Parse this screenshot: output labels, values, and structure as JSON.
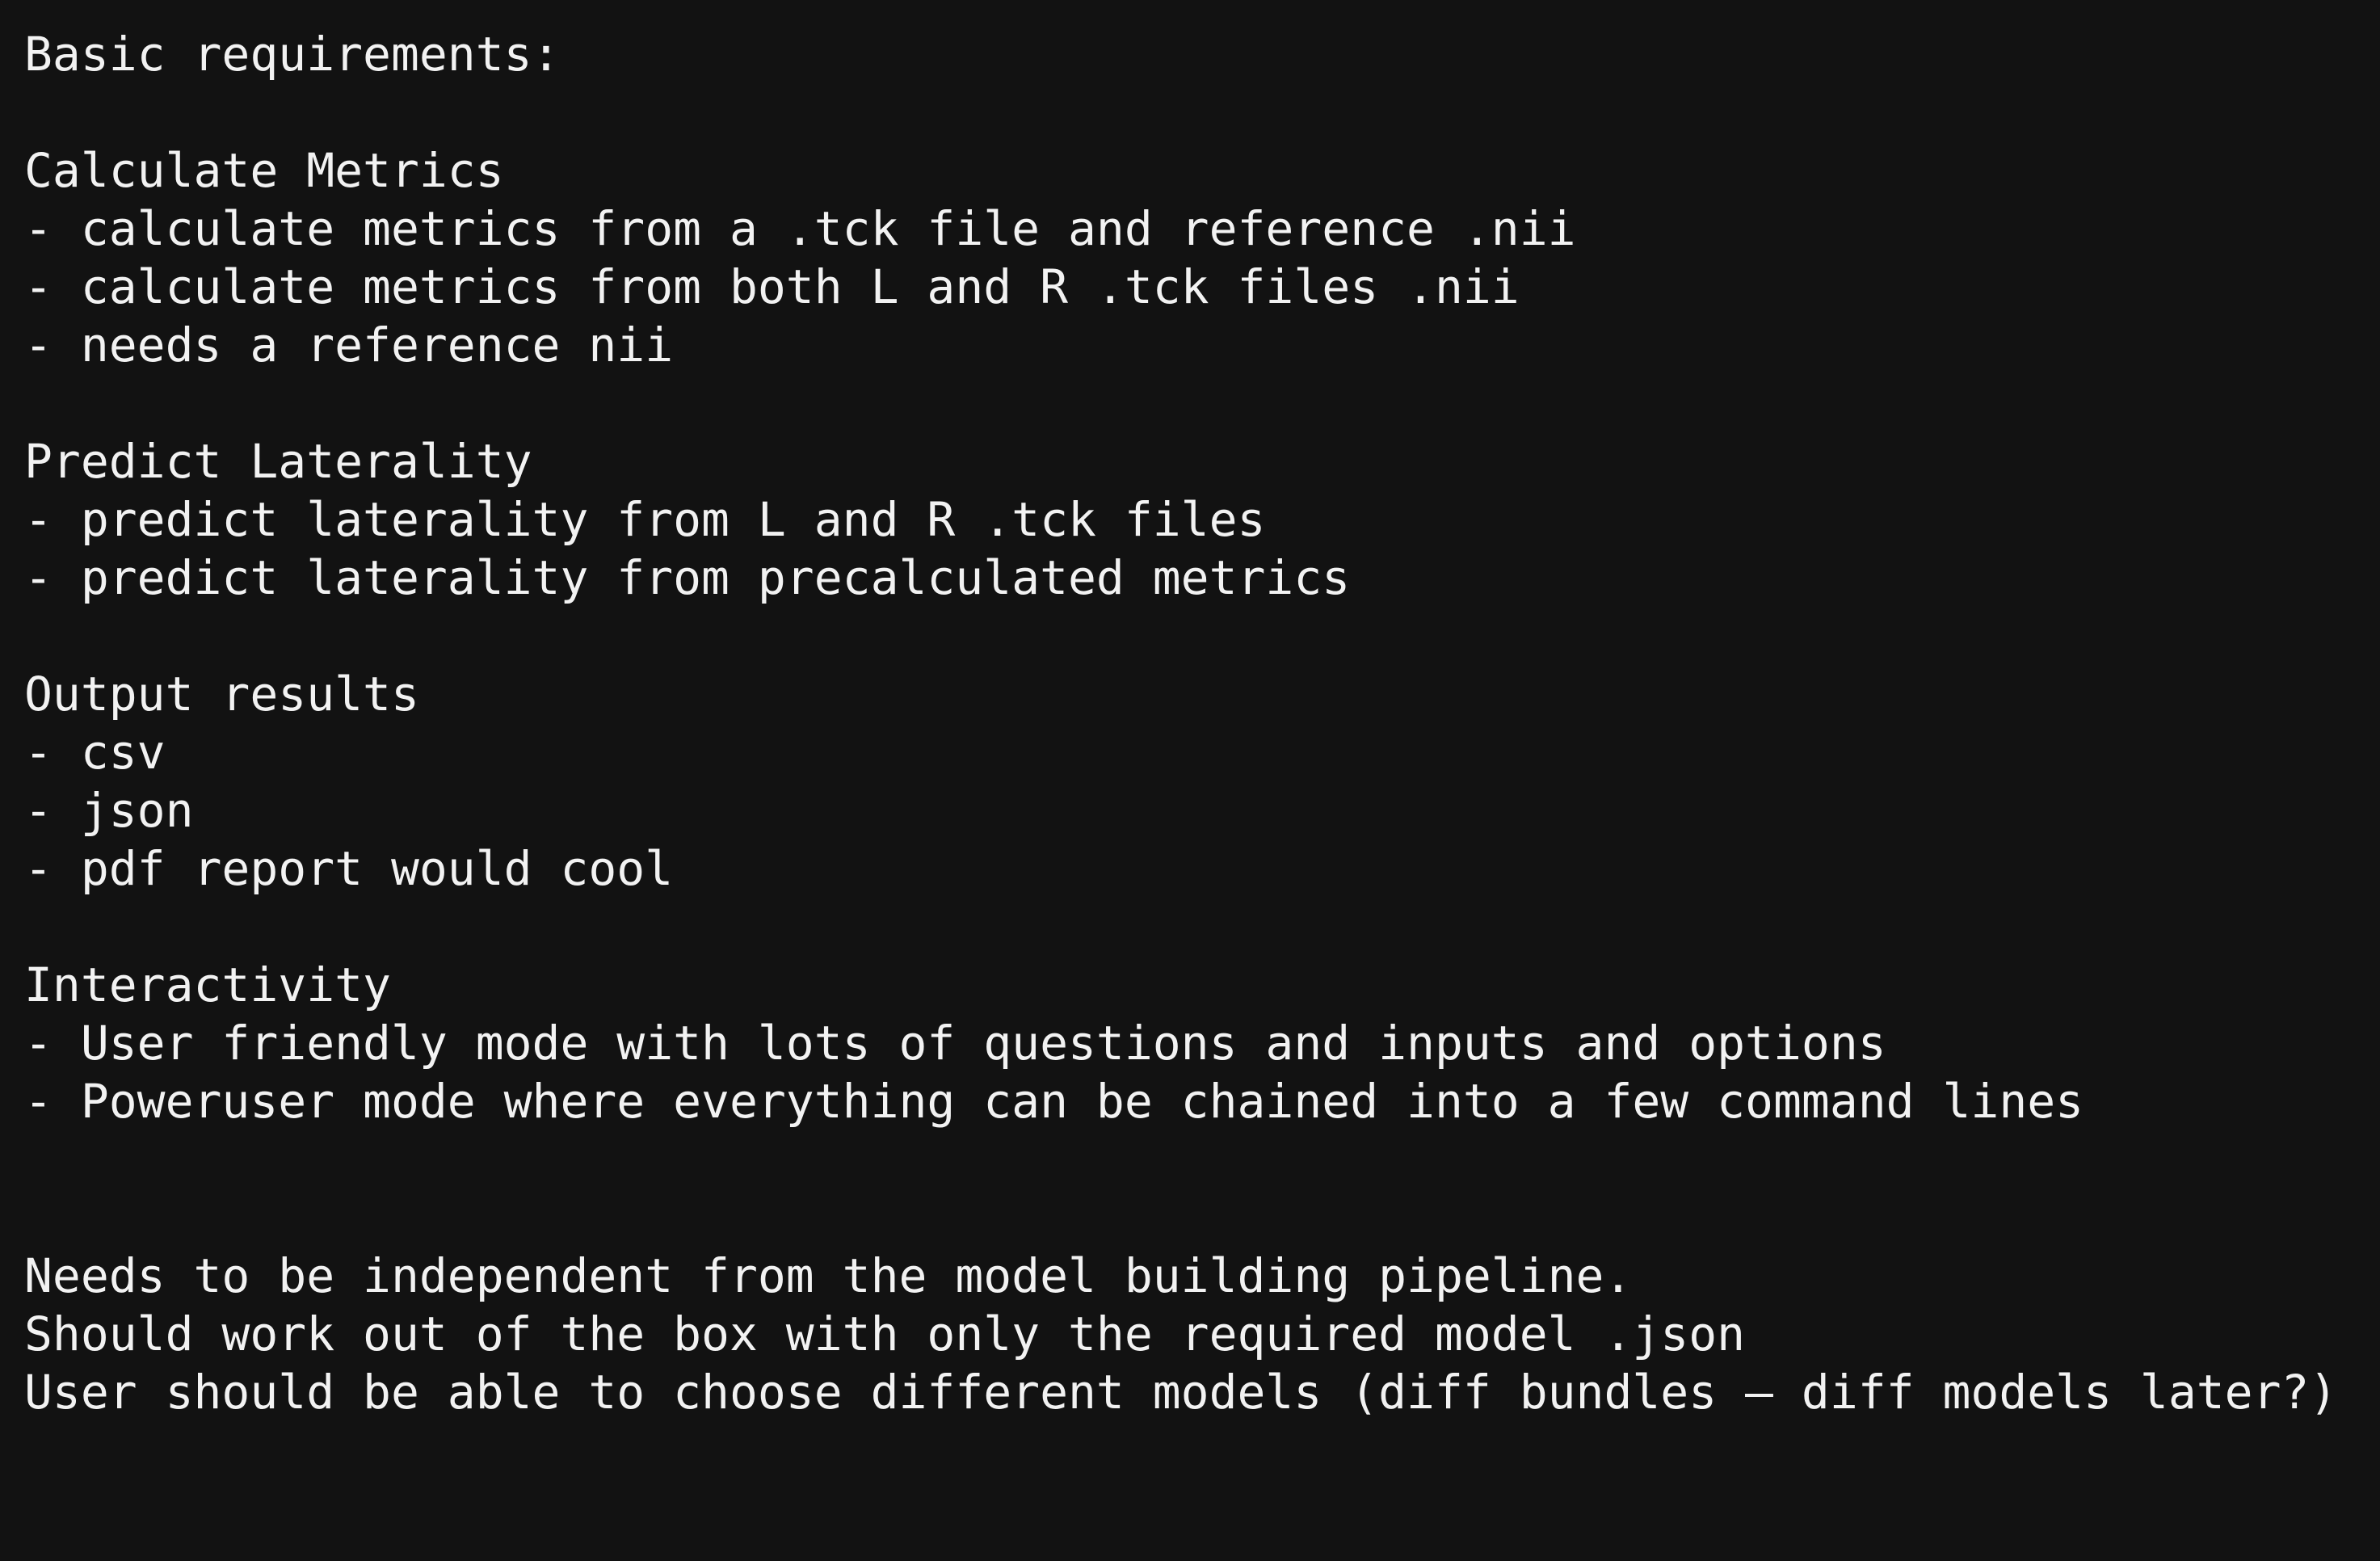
{
  "document": {
    "lines": [
      "Basic requirements:",
      "",
      "Calculate Metrics",
      "- calculate metrics from a .tck file and reference .nii",
      "- calculate metrics from both L and R .tck files .nii",
      "- needs a reference nii",
      "",
      "Predict Laterality",
      "- predict laterality from L and R .tck files",
      "- predict laterality from precalculated metrics",
      "",
      "Output results",
      "- csv",
      "- json",
      "- pdf report would cool",
      "",
      "Interactivity",
      "- User friendly mode with lots of questions and inputs and options",
      "- Poweruser mode where everything can be chained into a few command lines",
      "",
      "",
      "Needs to be independent from the model building pipeline.",
      "Should work out of the box with only the required model .json",
      "User should be able to choose different models (diff bundles – diff models later?)"
    ]
  },
  "colors": {
    "background": "#121212",
    "text": "#f2f2f2"
  }
}
